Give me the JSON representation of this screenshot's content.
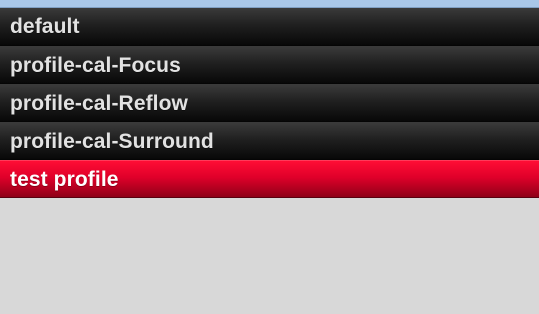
{
  "profiles": [
    {
      "label": "default",
      "selected": false
    },
    {
      "label": "profile-cal-Focus",
      "selected": false
    },
    {
      "label": "profile-cal-Reflow",
      "selected": false
    },
    {
      "label": "profile-cal-Surround",
      "selected": false
    },
    {
      "label": "test profile",
      "selected": true
    }
  ],
  "colors": {
    "top_strip": "#a9c7e8",
    "item_dark": "#202020",
    "selected_red": "#e0002a",
    "empty_background": "#d8d8d8"
  }
}
